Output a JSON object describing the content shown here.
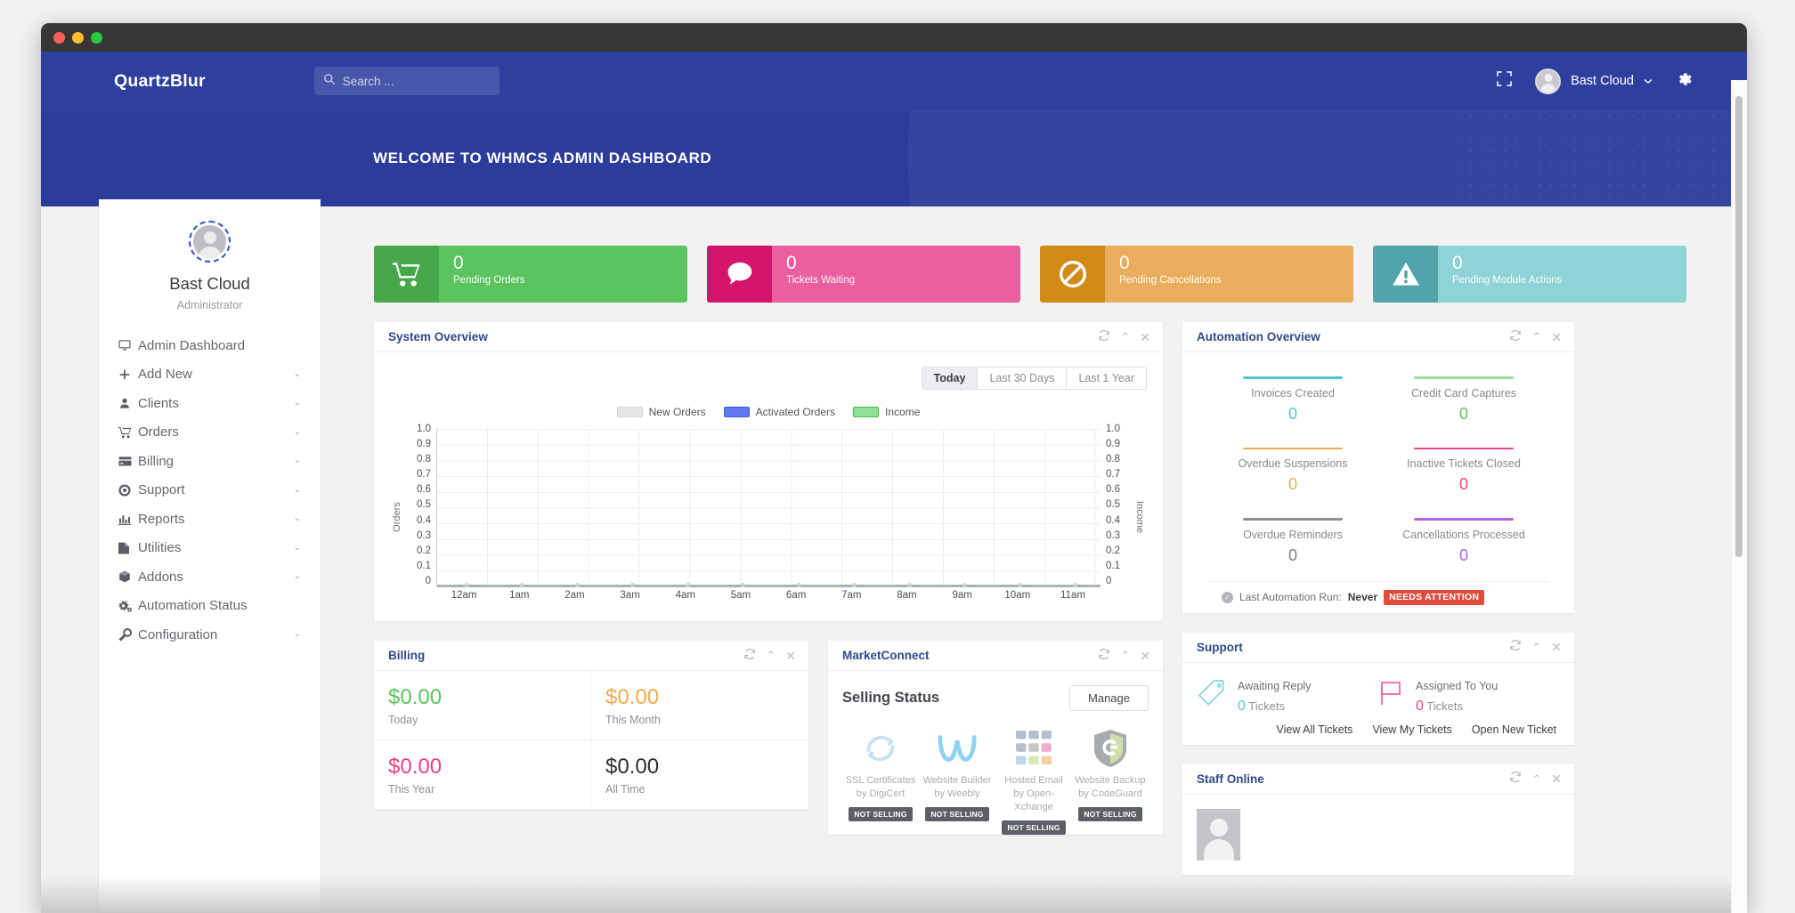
{
  "topbar": {
    "brand": "QuartzBlur",
    "search_placeholder": "Search ...",
    "expand_icon": "expand-icon",
    "user_name": "Bast Cloud",
    "gear_icon": "gear-icon"
  },
  "hero": {
    "welcome_title": "WELCOME TO WHMCS ADMIN DASHBOARD"
  },
  "sidebar": {
    "username": "Bast Cloud",
    "role": "Administrator",
    "items": [
      {
        "label": "Admin Dashboard",
        "icon": "monitor-icon",
        "caret": false
      },
      {
        "label": "Add New",
        "icon": "plus-icon",
        "caret": true
      },
      {
        "label": "Clients",
        "icon": "user-icon",
        "caret": true
      },
      {
        "label": "Orders",
        "icon": "cart-icon",
        "caret": true
      },
      {
        "label": "Billing",
        "icon": "card-icon",
        "caret": true
      },
      {
        "label": "Support",
        "icon": "lifering-icon",
        "caret": true
      },
      {
        "label": "Reports",
        "icon": "barchart-icon",
        "caret": true
      },
      {
        "label": "Utilities",
        "icon": "file-icon",
        "caret": true
      },
      {
        "label": "Addons",
        "icon": "box-icon",
        "caret": true
      },
      {
        "label": "Automation Status",
        "icon": "cogs-icon",
        "caret": false
      },
      {
        "label": "Configuration",
        "icon": "wrench-icon",
        "caret": true
      }
    ]
  },
  "stat_cards": [
    {
      "value": "0",
      "label": "Pending Orders",
      "icon": "cart-icon",
      "bg": "#5cc45e",
      "icon_bg": "#46a84a"
    },
    {
      "value": "0",
      "label": "Tickets Waiting",
      "icon": "comment-icon",
      "bg": "#ea5f9e",
      "icon_bg": "#d4156b"
    },
    {
      "value": "0",
      "label": "Pending Cancellations",
      "icon": "ban-icon",
      "bg": "#e9ad5c",
      "icon_bg": "#d18a16"
    },
    {
      "value": "0",
      "label": "Pending Module Actions",
      "icon": "warning-icon",
      "bg": "#8ed3d6",
      "icon_bg": "#4fa5aa"
    }
  ],
  "panels": {
    "system_overview": {
      "title": "System Overview",
      "refresh_icon": "refresh-icon",
      "collapse_icon": "chevron-up-icon",
      "close_icon": "close-icon"
    },
    "automation_overview": {
      "title": "Automation Overview",
      "refresh_icon": "refresh-icon",
      "collapse_icon": "chevron-up-icon",
      "close_icon": "close-icon"
    },
    "support": {
      "title": "Support",
      "refresh_icon": "refresh-icon",
      "collapse_icon": "chevron-up-icon",
      "close_icon": "close-icon"
    },
    "staff_online": {
      "title": "Staff Online",
      "refresh_icon": "refresh-icon",
      "collapse_icon": "chevron-up-icon",
      "close_icon": "close-icon"
    },
    "billing": {
      "title": "Billing",
      "refresh_icon": "refresh-icon",
      "collapse_icon": "chevron-up-icon",
      "close_icon": "close-icon"
    },
    "marketconnect": {
      "title": "MarketConnect",
      "refresh_icon": "refresh-icon",
      "collapse_icon": "chevron-up-icon",
      "close_icon": "close-icon"
    }
  },
  "range_tabs": [
    {
      "label": "Today",
      "active": true
    },
    {
      "label": "Last 30 Days",
      "active": false
    },
    {
      "label": "Last 1 Year",
      "active": false
    }
  ],
  "chart_data": {
    "type": "line",
    "title": "System Overview",
    "xlabel": "",
    "ylabel": "Orders",
    "y2label": "Income",
    "ylim": [
      0,
      1.0
    ],
    "y2lim": [
      0,
      1.0
    ],
    "yticks": [
      "1.0",
      "0.9",
      "0.8",
      "0.7",
      "0.6",
      "0.5",
      "0.4",
      "0.3",
      "0.2",
      "0.1",
      "0"
    ],
    "y2ticks": [
      "1.0",
      "0.9",
      "0.8",
      "0.7",
      "0.6",
      "0.5",
      "0.4",
      "0.3",
      "0.2",
      "0.1",
      "0"
    ],
    "grid": true,
    "legend_position": "top-center",
    "x": [
      "12am",
      "1am",
      "2am",
      "3am",
      "4am",
      "5am",
      "6am",
      "7am",
      "8am",
      "9am",
      "10am",
      "11am"
    ],
    "series": [
      {
        "name": "New Orders",
        "color": "#e6e6e6",
        "values": [
          0,
          0,
          0,
          0,
          0,
          0,
          0,
          0,
          0,
          0,
          0,
          0
        ]
      },
      {
        "name": "Activated Orders",
        "color": "#5d78f0",
        "values": [
          0,
          0,
          0,
          0,
          0,
          0,
          0,
          0,
          0,
          0,
          0,
          0
        ]
      },
      {
        "name": "Income",
        "color": "#66c96a",
        "values": [
          0,
          0,
          0,
          0,
          0,
          0,
          0,
          0,
          0,
          0,
          0,
          0
        ]
      }
    ]
  },
  "automation": {
    "cells": [
      {
        "label": "Invoices Created",
        "value": "0",
        "color": "#4cc9cf"
      },
      {
        "label": "Credit Card Captures",
        "value": "0",
        "color": "#74cc76"
      },
      {
        "label": "Overdue Suspensions",
        "value": "0",
        "color": "#efab4e"
      },
      {
        "label": "Inactive Tickets Closed",
        "value": "0",
        "color": "#ee3f86"
      },
      {
        "label": "Overdue Reminders",
        "value": "0",
        "color": "#8d8f97"
      },
      {
        "label": "Cancellations Processed",
        "value": "0",
        "color": "#b363e0"
      }
    ],
    "footer_label": "Last Automation Run:",
    "footer_value": "Never",
    "footer_badge": "NEEDS ATTENTION",
    "badge_color": "#e04b3c",
    "check_icon": "check-circle-icon"
  },
  "billing_cells": [
    {
      "value": "$0.00",
      "label": "Today",
      "color": "#5cc45e"
    },
    {
      "value": "$0.00",
      "label": "This Month",
      "color": "#efab4e"
    },
    {
      "value": "$0.00",
      "label": "This Year",
      "color": "#ee3f86"
    },
    {
      "value": "$0.00",
      "label": "All Time",
      "color": "#2e2f35"
    }
  ],
  "marketconnect": {
    "heading": "Selling Status",
    "manage_label": "Manage",
    "products": [
      {
        "name_line1": "SSL Certificates",
        "name_line2": "by DigiCert",
        "badge": "NOT SELLING",
        "icon": "digicert-logo-icon"
      },
      {
        "name_line1": "Website Builder",
        "name_line2": "by Weebly",
        "badge": "NOT SELLING",
        "icon": "weebly-logo-icon"
      },
      {
        "name_line1": "Hosted Email",
        "name_line2": "by Open-Xchange",
        "badge": "NOT SELLING",
        "icon": "openxchange-logo-icon"
      },
      {
        "name_line1": "Website Backup",
        "name_line2": "by CodeGuard",
        "badge": "NOT SELLING",
        "icon": "codeguard-logo-icon"
      }
    ]
  },
  "support": {
    "awaiting": {
      "label": "Awaiting Reply",
      "count": "0",
      "unit": "Tickets",
      "color": "#4cc9cf",
      "icon": "tag-icon"
    },
    "assigned": {
      "label": "Assigned To You",
      "count": "0",
      "unit": "Tickets",
      "color": "#ee3f86",
      "icon": "flag-icon"
    },
    "links": [
      "View All Tickets",
      "View My Tickets",
      "Open New Ticket"
    ]
  }
}
